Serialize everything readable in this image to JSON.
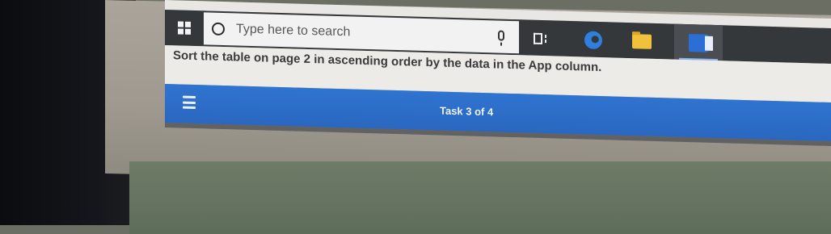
{
  "taskbar": {
    "search": {
      "placeholder": "Type here to search"
    },
    "icons": [
      "windows-start-icon",
      "search-circle-icon",
      "microphone-icon",
      "task-view-icon",
      "edge-browser-icon",
      "file-explorer-icon",
      "word-app-icon"
    ]
  },
  "instruction": {
    "text": "Sort the table on page 2 in ascending order by the data in the App column."
  },
  "task_bar": {
    "counter": "Task 3 of 4",
    "menu_icon": "hamburger-menu-icon"
  },
  "colors": {
    "taskbar_bg": "#35383b",
    "search_bg": "#f2f2f2",
    "instruction_bg": "#ecebe8",
    "task_bar_blue": "#2f74d0"
  }
}
